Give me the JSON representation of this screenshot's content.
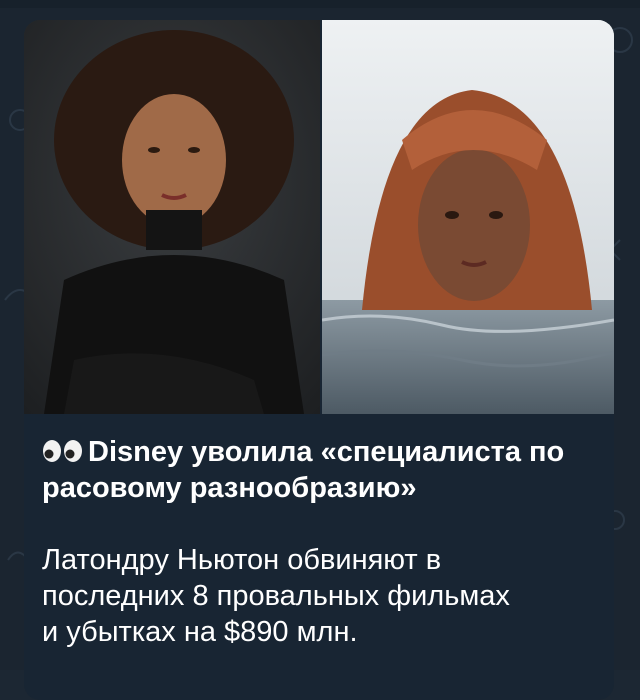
{
  "post": {
    "headline": "Disney уволила «специалиста по расовому разнообразию»",
    "body": "Латондру Ньютон обвиняют в\nпоследних 8 провальных фильмах\nи убытках на $890 млн.",
    "emoji_icon": "eyes-icon"
  },
  "media": {
    "left_photo_icon": "portrait-photo",
    "right_photo_icon": "mermaid-in-water-photo"
  },
  "colors": {
    "background": "#1b2530",
    "bubble": "#182533",
    "text": "#ffffff"
  }
}
